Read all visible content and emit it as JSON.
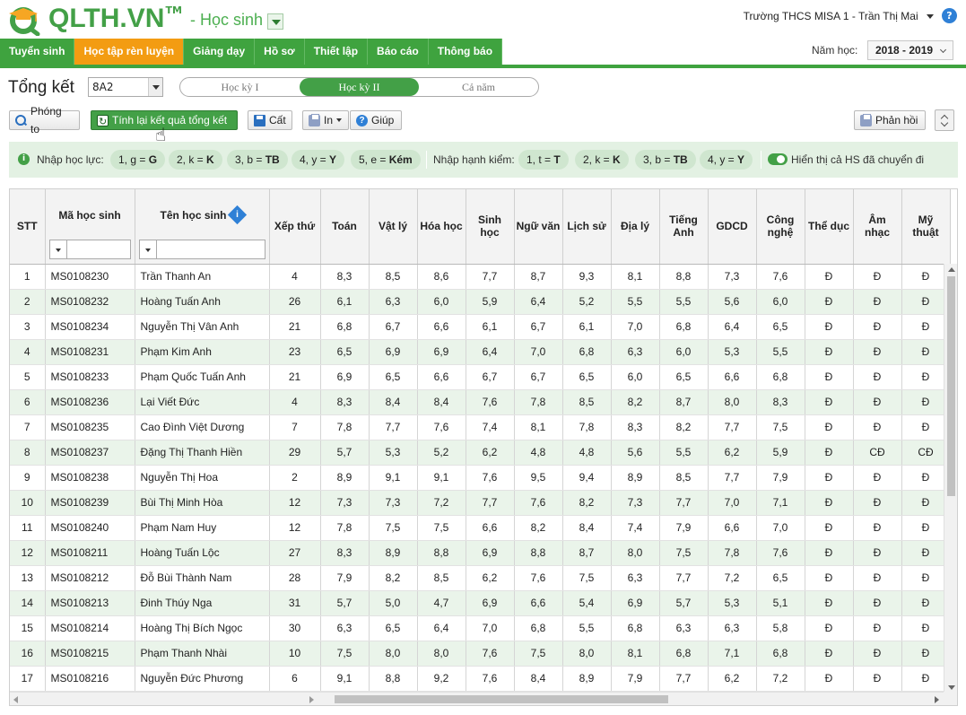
{
  "app": {
    "brand": "QLTH.VN",
    "tm": "TM",
    "module": "- Học sinh"
  },
  "user": {
    "school_user": "Trường THCS MISA 1 - Trần Thị Mai"
  },
  "nav": [
    "Tuyển sinh",
    "Học tập rèn luyện",
    "Giảng dạy",
    "Hồ sơ",
    "Thiết lập",
    "Báo cáo",
    "Thông báo"
  ],
  "nav_active": 1,
  "year": {
    "label": "Năm học:",
    "value": "2018 - 2019"
  },
  "summary": {
    "title": "Tổng kết",
    "class_value": "8A2",
    "terms": [
      "Học kỳ I",
      "Học kỳ II",
      "Cả năm"
    ],
    "active_term": 1
  },
  "toolbar": {
    "zoom": "Phóng to",
    "recalc": "Tính lại kết quả tổng kết",
    "save": "Cất",
    "print": "In",
    "help": "Giúp",
    "feedback": "Phản hồi"
  },
  "filters": {
    "hoc_luc_label": "Nhập học lực:",
    "hoc_luc": [
      {
        "code": "1, g =",
        "val": "G"
      },
      {
        "code": "2, k =",
        "val": "K"
      },
      {
        "code": "3, b =",
        "val": "TB"
      },
      {
        "code": "4, y =",
        "val": "Y"
      },
      {
        "code": "5, e =",
        "val": "Kém"
      }
    ],
    "hanh_kiem_label": "Nhập hạnh kiểm:",
    "hanh_kiem": [
      {
        "code": "1, t =",
        "val": "T"
      },
      {
        "code": "2, k =",
        "val": "K"
      },
      {
        "code": "3, b =",
        "val": "TB"
      },
      {
        "code": "4, y =",
        "val": "Y"
      }
    ],
    "toggle_label": "Hiển thị cả HS đã chuyển đi"
  },
  "table": {
    "headers": [
      "STT",
      "Mã học sinh",
      "Tên học sinh",
      "Xếp thứ",
      "Toán",
      "Vật lý",
      "Hóa học",
      "Sinh học",
      "Ngữ văn",
      "Lịch sử",
      "Địa lý",
      "Tiếng Anh",
      "GDCD",
      "Công nghệ",
      "Thể dục",
      "Âm nhạc",
      "Mỹ thuật"
    ],
    "rows": [
      [
        "1",
        "MS0108230",
        "Trần Thanh An",
        "4",
        "8,3",
        "8,5",
        "8,6",
        "7,7",
        "8,7",
        "9,3",
        "8,1",
        "8,8",
        "7,3",
        "7,6",
        "Đ",
        "Đ",
        "Đ"
      ],
      [
        "2",
        "MS0108232",
        "Hoàng Tuấn Anh",
        "26",
        "6,1",
        "6,3",
        "6,0",
        "5,9",
        "6,4",
        "5,2",
        "5,5",
        "5,5",
        "5,6",
        "6,0",
        "Đ",
        "Đ",
        "Đ"
      ],
      [
        "3",
        "MS0108234",
        "Nguyễn Thị Vân Anh",
        "21",
        "6,8",
        "6,7",
        "6,6",
        "6,1",
        "6,7",
        "6,1",
        "7,0",
        "6,8",
        "6,4",
        "6,5",
        "Đ",
        "Đ",
        "Đ"
      ],
      [
        "4",
        "MS0108231",
        "Phạm Kim Anh",
        "23",
        "6,5",
        "6,9",
        "6,9",
        "6,4",
        "7,0",
        "6,8",
        "6,3",
        "6,0",
        "5,3",
        "5,5",
        "Đ",
        "Đ",
        "Đ"
      ],
      [
        "5",
        "MS0108233",
        "Phạm Quốc Tuấn Anh",
        "21",
        "6,9",
        "6,5",
        "6,6",
        "6,7",
        "6,7",
        "6,5",
        "6,0",
        "6,5",
        "6,6",
        "6,8",
        "Đ",
        "Đ",
        "Đ"
      ],
      [
        "6",
        "MS0108236",
        "Lại Viết Đức",
        "4",
        "8,3",
        "8,4",
        "8,4",
        "7,6",
        "7,8",
        "8,5",
        "8,2",
        "8,7",
        "8,0",
        "8,3",
        "Đ",
        "Đ",
        "Đ"
      ],
      [
        "7",
        "MS0108235",
        "Cao Đình Việt Dương",
        "7",
        "7,8",
        "7,7",
        "7,6",
        "7,4",
        "8,1",
        "7,8",
        "8,3",
        "8,2",
        "7,7",
        "7,5",
        "Đ",
        "Đ",
        "Đ"
      ],
      [
        "8",
        "MS0108237",
        "Đặng Thị Thanh Hiền",
        "29",
        "5,7",
        "5,3",
        "5,2",
        "6,2",
        "4,8",
        "4,8",
        "5,6",
        "5,5",
        "6,2",
        "5,9",
        "Đ",
        "CĐ",
        "CĐ"
      ],
      [
        "9",
        "MS0108238",
        "Nguyễn Thị Hoa",
        "2",
        "8,9",
        "9,1",
        "9,1",
        "7,6",
        "9,5",
        "9,4",
        "8,9",
        "8,5",
        "7,7",
        "7,9",
        "Đ",
        "Đ",
        "Đ"
      ],
      [
        "10",
        "MS0108239",
        "Bùi Thị Minh Hòa",
        "12",
        "7,3",
        "7,3",
        "7,2",
        "7,7",
        "7,6",
        "8,2",
        "7,3",
        "7,7",
        "7,0",
        "7,1",
        "Đ",
        "Đ",
        "Đ"
      ],
      [
        "11",
        "MS0108240",
        "Phạm Nam Huy",
        "12",
        "7,8",
        "7,5",
        "7,5",
        "6,6",
        "8,2",
        "8,4",
        "7,4",
        "7,9",
        "6,6",
        "7,0",
        "Đ",
        "Đ",
        "Đ"
      ],
      [
        "12",
        "MS0108211",
        "Hoàng Tuấn Lộc",
        "27",
        "8,3",
        "8,9",
        "8,8",
        "6,9",
        "8,8",
        "8,7",
        "8,0",
        "7,5",
        "7,8",
        "7,6",
        "Đ",
        "Đ",
        "Đ"
      ],
      [
        "13",
        "MS0108212",
        "Đỗ Bùi Thành Nam",
        "28",
        "7,9",
        "8,2",
        "8,5",
        "6,2",
        "7,6",
        "7,5",
        "6,3",
        "7,7",
        "7,2",
        "6,5",
        "Đ",
        "Đ",
        "Đ"
      ],
      [
        "14",
        "MS0108213",
        "Đinh Thúy Nga",
        "31",
        "5,7",
        "5,0",
        "4,7",
        "6,9",
        "6,6",
        "5,4",
        "6,9",
        "5,7",
        "5,3",
        "5,1",
        "Đ",
        "Đ",
        "Đ"
      ],
      [
        "15",
        "MS0108214",
        "Hoàng Thị Bích Ngọc",
        "30",
        "6,3",
        "6,5",
        "6,4",
        "7,0",
        "6,8",
        "5,5",
        "6,8",
        "6,3",
        "6,3",
        "5,8",
        "Đ",
        "Đ",
        "Đ"
      ],
      [
        "16",
        "MS0108215",
        "Phạm Thanh Nhài",
        "10",
        "7,5",
        "8,0",
        "8,0",
        "7,6",
        "7,5",
        "8,0",
        "8,1",
        "6,8",
        "7,1",
        "6,8",
        "Đ",
        "Đ",
        "Đ"
      ],
      [
        "17",
        "MS0108216",
        "Nguyễn Đức Phương",
        "6",
        "9,1",
        "8,8",
        "9,2",
        "7,6",
        "8,4",
        "8,9",
        "7,9",
        "7,7",
        "6,2",
        "7,2",
        "Đ",
        "Đ",
        "Đ"
      ]
    ]
  }
}
